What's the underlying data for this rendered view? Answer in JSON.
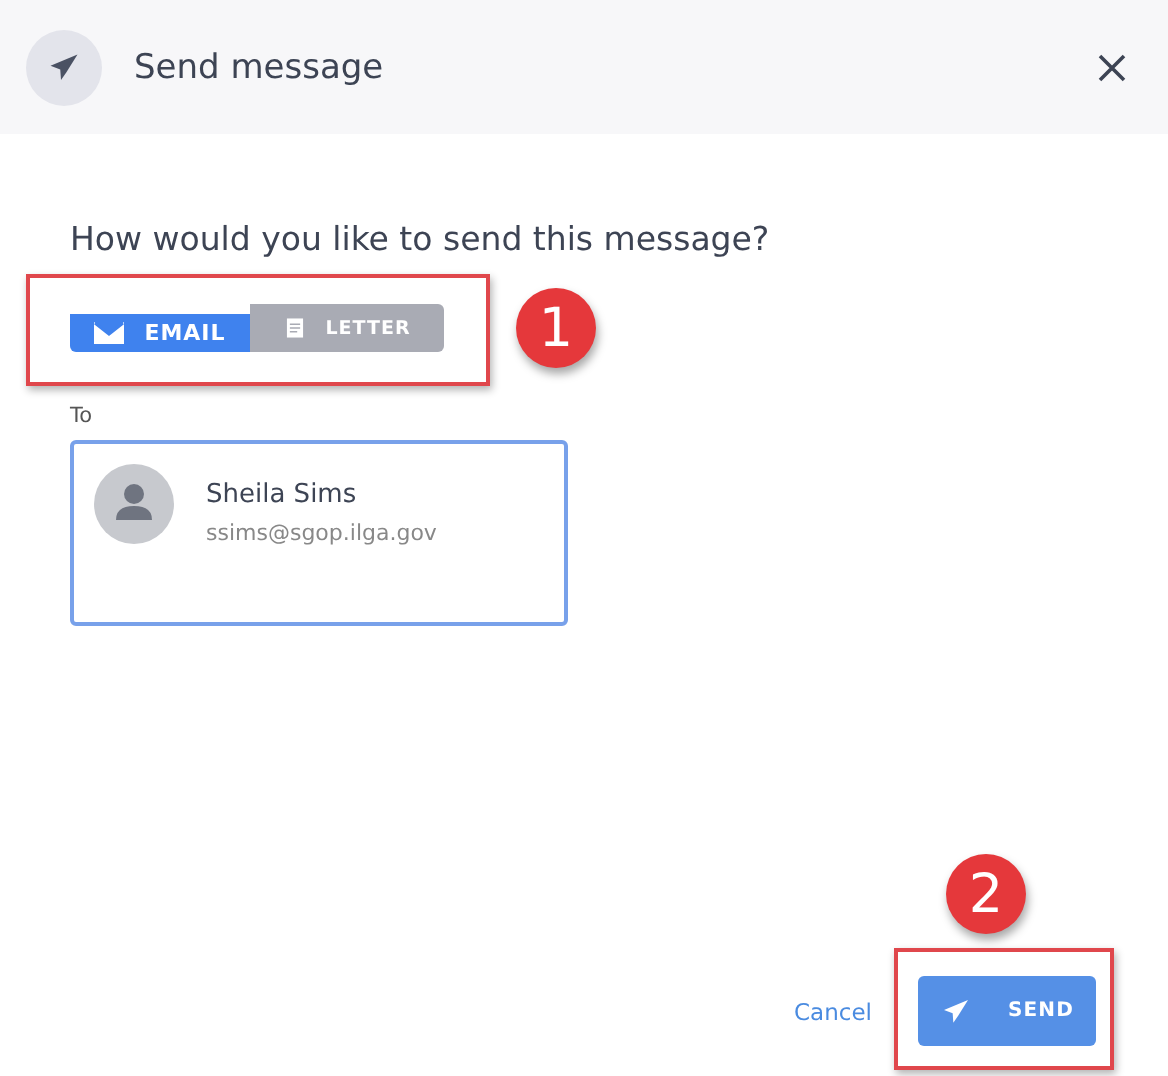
{
  "dialog": {
    "title": "Send message",
    "question": "How would you like to send this message?",
    "methods": [
      {
        "label": "EMAIL",
        "kind": "email",
        "selected": true
      },
      {
        "label": "LETTER",
        "kind": "letter",
        "selected": false
      }
    ],
    "to_label": "To",
    "recipient": {
      "name": "Sheila Sims",
      "email": "ssims@sgop.ilga.gov"
    },
    "cancel": "Cancel",
    "send": "SEND"
  },
  "callouts": [
    {
      "number": "1"
    },
    {
      "number": "2"
    }
  ]
}
